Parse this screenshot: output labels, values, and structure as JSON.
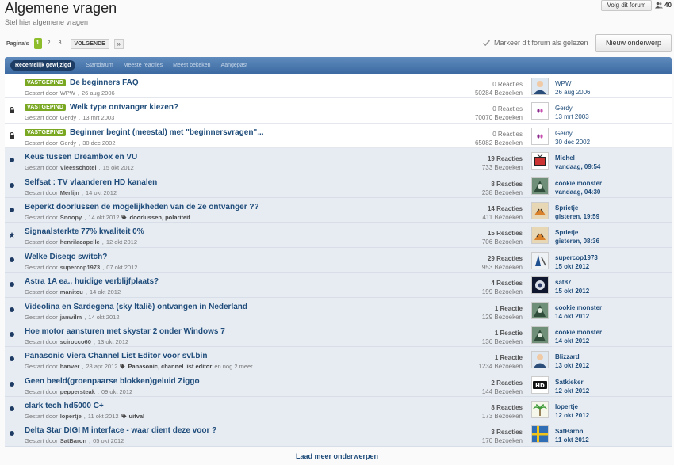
{
  "header": {
    "title": "Algemene vragen",
    "subtitle": "Stel hier algemene vragen",
    "follow_label": "Volg dit forum",
    "followers_count": "40"
  },
  "pagination": {
    "label": "Pagina's",
    "pages": [
      "1",
      "2",
      "3"
    ],
    "current": "1",
    "next_label": "VOLGENDE",
    "last_label": "»"
  },
  "actions": {
    "mark_read_label": "Markeer dit forum als gelezen",
    "new_topic_label": "Nieuw onderwerp"
  },
  "tabs": [
    {
      "label": "Recentelijk gewijzigd",
      "active": true
    },
    {
      "label": "Startdatum",
      "active": false
    },
    {
      "label": "Meeste reacties",
      "active": false
    },
    {
      "label": "Meest bekeken",
      "active": false
    },
    {
      "label": "Aangepast",
      "active": false
    }
  ],
  "topics": [
    {
      "marker": "none",
      "pinned": true,
      "pinned_label": "VASTGEPIND",
      "title": "De beginners FAQ",
      "started_prefix": "Gestart door",
      "author": "WPW",
      "date": "26 aug 2006",
      "tags": "",
      "tags_more": "",
      "replies": "0 Reacties",
      "views": "50284 Bezoeken",
      "avatar": "person",
      "last_user": "WPW",
      "last_date": "26 aug 2006",
      "unread": false
    },
    {
      "marker": "lock-icon",
      "pinned": true,
      "pinned_label": "VASTGEPIND",
      "title": "Welk type ontvanger kiezen?",
      "started_prefix": "Gestart door",
      "author": "Gerdy",
      "date": "13 mrt 2003",
      "tags": "",
      "tags_more": "",
      "replies": "0 Reacties",
      "views": "70070 Bezoeken",
      "avatar": "gerdy",
      "last_user": "Gerdy",
      "last_date": "13 mrt 2003",
      "unread": false
    },
    {
      "marker": "lock-icon",
      "pinned": true,
      "pinned_label": "VASTGEPIND",
      "title": "Beginner begint (meestal) met \"beginnersvragen\"...",
      "started_prefix": "Gestart door",
      "author": "Gerdy",
      "date": "30 dec 2002",
      "tags": "",
      "tags_more": "",
      "replies": "0 Reacties",
      "views": "65082 Bezoeken",
      "avatar": "gerdy",
      "last_user": "Gerdy",
      "last_date": "30 dec 2002",
      "unread": false
    },
    {
      "marker": "dot",
      "pinned": false,
      "title": "Keus tussen Dreambox en VU",
      "started_prefix": "Gestart door",
      "author": "Vleesschotel",
      "date": "15 okt 2012",
      "tags": "",
      "tags_more": "",
      "replies": "19 Reacties",
      "views": "733 Bezoeken",
      "avatar": "tv",
      "last_user": "Michel",
      "last_date": "vandaag, 09:54",
      "unread": true
    },
    {
      "marker": "dot",
      "pinned": false,
      "title": "Selfsat : TV vlaanderen HD kanalen",
      "started_prefix": "Gestart door",
      "author": "Merlijn",
      "date": "14 okt 2012",
      "tags": "",
      "tags_more": "",
      "replies": "8 Reacties",
      "views": "238 Bezoeken",
      "avatar": "monster",
      "last_user": "cookie monster",
      "last_date": "vandaag, 04:30",
      "unread": true
    },
    {
      "marker": "dot",
      "pinned": false,
      "title": "Beperkt doorlussen de mogelijkheden van de 2e ontvanger ??",
      "started_prefix": "Gestart door",
      "author": "Snoopy",
      "date": "14 okt 2012",
      "tags": "doorlussen, polariteit",
      "tags_more": "",
      "replies": "14 Reacties",
      "views": "411 Bezoeken",
      "avatar": "tiger",
      "last_user": "Sprietje",
      "last_date": "gisteren, 19:59",
      "unread": true
    },
    {
      "marker": "star-icon",
      "pinned": false,
      "title": "Signaalsterkte 77% kwaliteit 0%",
      "started_prefix": "Gestart door",
      "author": "henrilacapelle",
      "date": "12 okt 2012",
      "tags": "",
      "tags_more": "",
      "replies": "15 Reacties",
      "views": "706 Bezoeken",
      "avatar": "tiger",
      "last_user": "Sprietje",
      "last_date": "gisteren, 08:36",
      "unread": true
    },
    {
      "marker": "dot",
      "pinned": false,
      "title": "Welke Diseqc switch?",
      "started_prefix": "Gestart door",
      "author": "supercop1973",
      "date": "07 okt 2012",
      "tags": "",
      "tags_more": "",
      "replies": "29 Reacties",
      "views": "953 Bezoeken",
      "avatar": "cop",
      "last_user": "supercop1973",
      "last_date": "15 okt 2012",
      "unread": true
    },
    {
      "marker": "dot",
      "pinned": false,
      "title": "Astra 1A ea., huidige verblijfplaats?",
      "started_prefix": "Gestart door",
      "author": "manitou",
      "date": "14 okt 2012",
      "tags": "",
      "tags_more": "",
      "replies": "4 Reacties",
      "views": "199 Bezoeken",
      "avatar": "sat87",
      "last_user": "sat87",
      "last_date": "15 okt 2012",
      "unread": true
    },
    {
      "marker": "dot",
      "pinned": false,
      "title": "Videolina en Sardegena (sky Italië) ontvangen in Nederland",
      "started_prefix": "Gestart door",
      "author": "janwilm",
      "date": "14 okt 2012",
      "tags": "",
      "tags_more": "",
      "replies": "1 Reactie",
      "views": "129 Bezoeken",
      "avatar": "monster",
      "last_user": "cookie monster",
      "last_date": "14 okt 2012",
      "unread": true
    },
    {
      "marker": "dot",
      "pinned": false,
      "title": "Hoe motor aansturen met skystar 2 onder Windows 7",
      "started_prefix": "Gestart door",
      "author": "scirocco60",
      "date": "13 okt 2012",
      "tags": "",
      "tags_more": "",
      "replies": "1 Reactie",
      "views": "136 Bezoeken",
      "avatar": "monster",
      "last_user": "cookie monster",
      "last_date": "14 okt 2012",
      "unread": true
    },
    {
      "marker": "dot",
      "pinned": false,
      "title": "Panasonic Viera Channel List Editor voor svl.bin",
      "started_prefix": "Gestart door",
      "author": "hanver",
      "date": "28 apr 2012",
      "tags": "Panasonic, channel list editor",
      "tags_more": "en nog 2 meer...",
      "replies": "1 Reactie",
      "views": "1234 Bezoeken",
      "avatar": "person",
      "last_user": "Blizzard",
      "last_date": "13 okt 2012",
      "unread": true
    },
    {
      "marker": "dot",
      "pinned": false,
      "title": "Geen beeld(groenpaarse blokken)geluid Ziggo",
      "started_prefix": "Gestart door",
      "author": "peppersteak",
      "date": "09 okt 2012",
      "tags": "",
      "tags_more": "",
      "replies": "2 Reacties",
      "views": "144 Bezoeken",
      "avatar": "hd",
      "last_user": "Satkieker",
      "last_date": "12 okt 2012",
      "unread": true
    },
    {
      "marker": "dot",
      "pinned": false,
      "title": "clark tech hd5000 C+",
      "started_prefix": "Gestart door",
      "author": "lopertje",
      "date": "11 okt 2012",
      "tags": "uitval",
      "tags_more": "",
      "replies": "8 Reacties",
      "views": "173 Bezoeken",
      "avatar": "palm",
      "last_user": "lopertje",
      "last_date": "12 okt 2012",
      "unread": true
    },
    {
      "marker": "dot",
      "pinned": false,
      "title": "Delta Star DIGI M interface - waar dient deze voor ?",
      "started_prefix": "Gestart door",
      "author": "SatBaron",
      "date": "05 okt 2012",
      "tags": "",
      "tags_more": "",
      "replies": "3 Reacties",
      "views": "170 Bezoeken",
      "avatar": "sweden",
      "last_user": "SatBaron",
      "last_date": "11 okt 2012",
      "unread": true
    }
  ],
  "footer": {
    "load_more_label": "Laad meer onderwerpen"
  }
}
